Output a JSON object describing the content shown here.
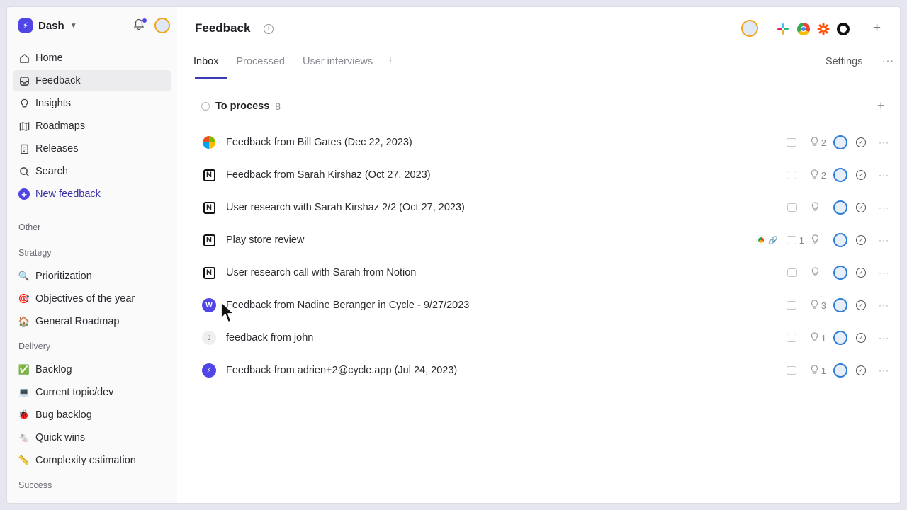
{
  "workspace": {
    "name": "Dash"
  },
  "sidebar": {
    "nav": [
      {
        "label": "Home",
        "icon": "home-icon"
      },
      {
        "label": "Feedback",
        "icon": "inbox-icon",
        "active": true
      },
      {
        "label": "Insights",
        "icon": "bulb-icon"
      },
      {
        "label": "Roadmaps",
        "icon": "map-icon"
      },
      {
        "label": "Releases",
        "icon": "document-icon"
      },
      {
        "label": "Search",
        "icon": "search-icon"
      }
    ],
    "new_feedback": "New feedback",
    "sections": {
      "other": "Other",
      "strategy": "Strategy",
      "delivery": "Delivery",
      "success": "Success"
    },
    "strategy_items": [
      {
        "emoji": "🔍",
        "label": "Prioritization"
      },
      {
        "emoji": "🎯",
        "label": "Objectives of the year"
      },
      {
        "emoji": "🏠",
        "label": "General Roadmap"
      }
    ],
    "delivery_items": [
      {
        "emoji": "✅",
        "label": "Backlog"
      },
      {
        "emoji": "💻",
        "label": "Current topic/dev"
      },
      {
        "emoji": "🐞",
        "label": "Bug backlog"
      },
      {
        "emoji": "🐁",
        "label": "Quick wins"
      },
      {
        "emoji": "📏",
        "label": "Complexity estimation"
      }
    ]
  },
  "header": {
    "title": "Feedback",
    "tabs": [
      "Inbox",
      "Processed",
      "User interviews"
    ],
    "active_tab": "Inbox",
    "settings": "Settings",
    "integrations": [
      "slack-icon",
      "chrome-icon",
      "zapier-icon",
      "circle-icon"
    ]
  },
  "group": {
    "name": "To process",
    "count": "8"
  },
  "rows": [
    {
      "title": "Feedback from Bill Gates (Dec 22, 2023)",
      "source": "microsoft",
      "comments": "",
      "insights": "2"
    },
    {
      "title": "Feedback from Sarah Kirshaz (Oct 27, 2023)",
      "source": "notion",
      "comments": "",
      "insights": "2"
    },
    {
      "title": "User research with Sarah Kirshaz 2/2 (Oct 27, 2023)",
      "source": "notion",
      "comments": "",
      "insights": ""
    },
    {
      "title": "Play store review",
      "source": "notion",
      "comments": "1",
      "insights": "",
      "chips": [
        "chrome-icon",
        "link-icon"
      ]
    },
    {
      "title": "User research call with Sarah from Notion",
      "source": "notion",
      "comments": "",
      "insights": ""
    },
    {
      "title": "Feedback from Nadine Beranger in Cycle - 9/27/2023",
      "source": "cycle-avatar",
      "source_text": "W",
      "comments": "",
      "insights": "3"
    },
    {
      "title": "feedback from john",
      "source": "letter-avatar",
      "source_text": "J",
      "comments": "",
      "insights": "1"
    },
    {
      "title": "Feedback from adrien+2@cycle.app (Jul 24, 2023)",
      "source": "cycle-logo",
      "comments": "",
      "insights": "1"
    }
  ],
  "colors": {
    "accent": "#4f46e5",
    "assignee_ring": "#2f7fd9",
    "avatar_ring": "#f2a31b"
  }
}
